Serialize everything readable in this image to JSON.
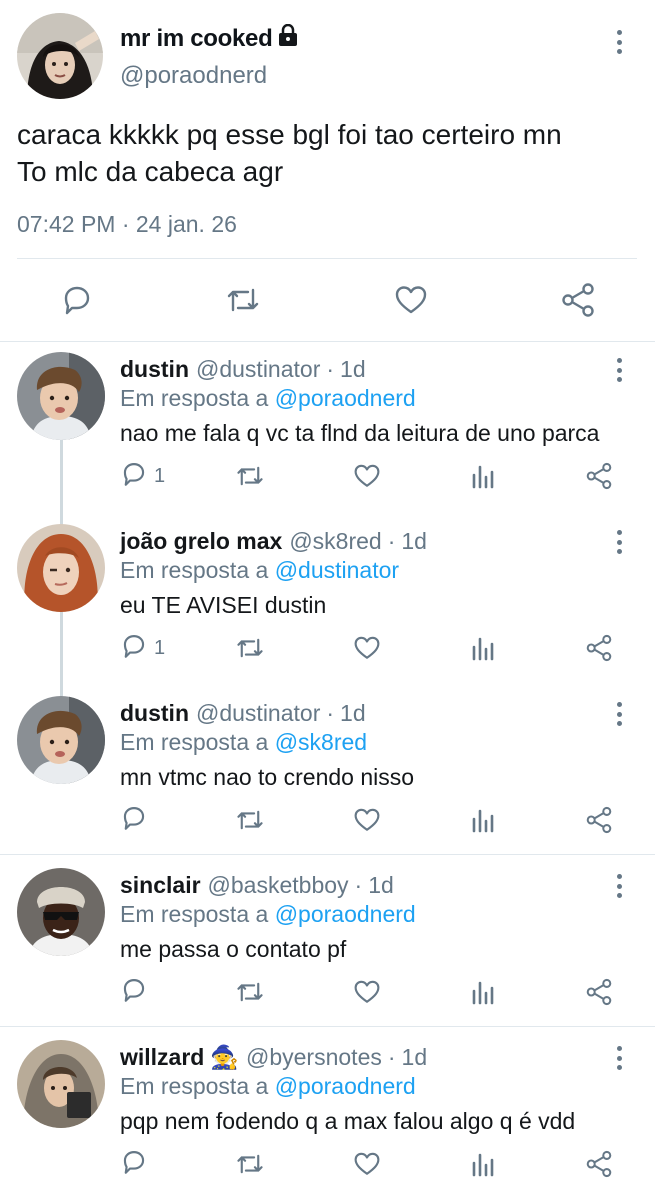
{
  "main_tweet": {
    "display_name": "mr im cooked",
    "handle": "@poraodnerd",
    "text_lines": [
      "caraca kkkkk pq esse bgl foi tao certeiro mn",
      "To mlc da cabeca agr"
    ],
    "timestamp": "07:42 PM · 24 jan. 26",
    "protected_icon": "lock-icon",
    "actions": [
      "reply-icon",
      "retweet-icon",
      "like-icon",
      "share-icon"
    ]
  },
  "replies": [
    {
      "name": "dustin",
      "handle": "@dustinator",
      "dot": "·",
      "age": "1d",
      "replying_prefix": "Em resposta a",
      "mention": "@poraodnerd",
      "text": "nao me fala q vc ta flnd da leitura de uno parca",
      "reply_count": "1"
    },
    {
      "name": "joão grelo max",
      "handle": "@sk8red",
      "dot": "·",
      "age": "1d",
      "replying_prefix": "Em resposta a",
      "mention": "@dustinator",
      "text": "eu TE AVISEI dustin",
      "reply_count": "1"
    },
    {
      "name": "dustin",
      "handle": "@dustinator",
      "dot": "·",
      "age": "1d",
      "replying_prefix": "Em resposta a",
      "mention": "@sk8red",
      "text": "mn vtmc nao to crendo nisso",
      "reply_count": ""
    },
    {
      "name": "sinclair",
      "handle": "@basketbboy",
      "dot": "·",
      "age": "1d",
      "replying_prefix": "Em resposta a",
      "mention": "@poraodnerd",
      "text": "me passa o contato pf",
      "reply_count": ""
    },
    {
      "name": "willzard",
      "name_emoji": "🧙",
      "handle": "@byersnotes",
      "dot": "·",
      "age": "1d",
      "replying_prefix": "Em resposta a",
      "mention": "@poraodnerd",
      "text": "pqp nem fodendo q a max falou algo q é vdd",
      "reply_count": ""
    }
  ],
  "colors": {
    "text": "#14171a",
    "secondary": "#657786",
    "mention": "#1da1f2",
    "divider": "#e1e8ed",
    "thread_line": "#cfd9de"
  }
}
